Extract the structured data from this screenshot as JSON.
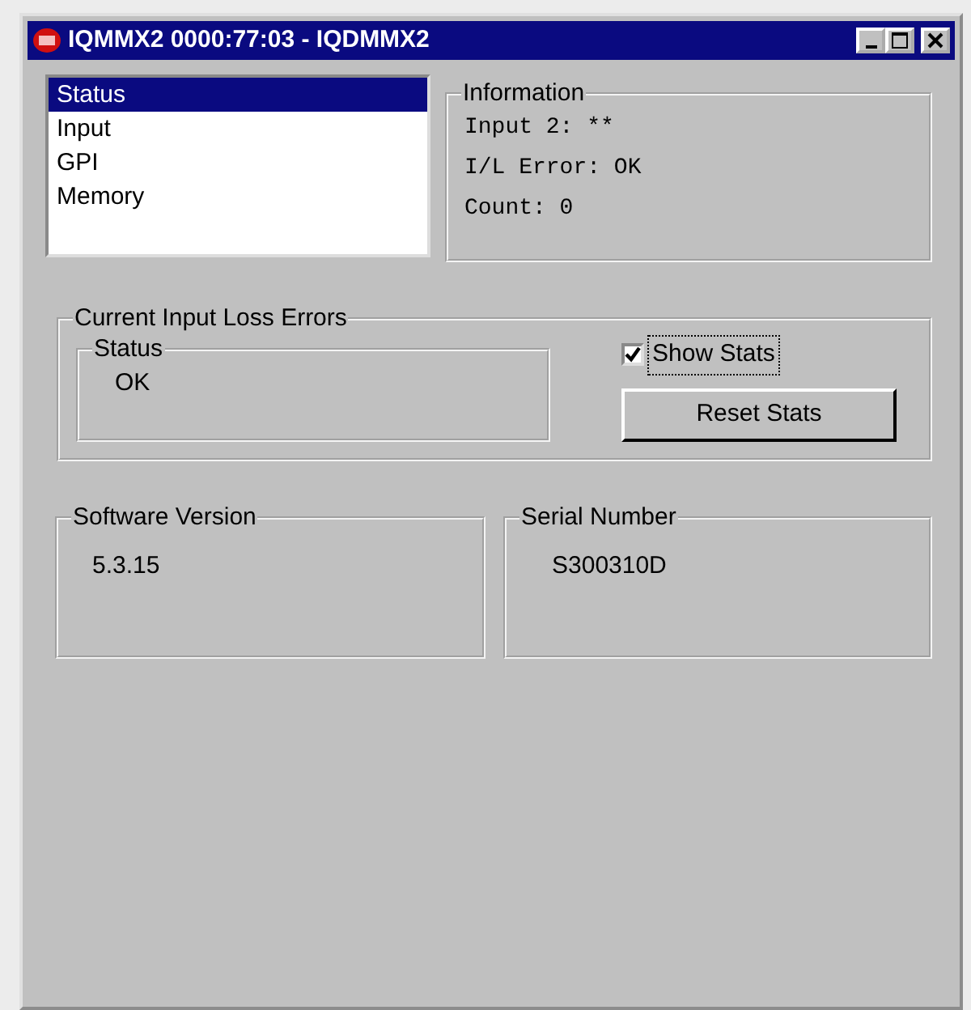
{
  "window": {
    "title": "IQMMX2 0000:77:03 - IQDMMX2"
  },
  "list": [
    {
      "label": "Status",
      "selected": true
    },
    {
      "label": "Input",
      "selected": false
    },
    {
      "label": "GPI",
      "selected": false
    },
    {
      "label": "Memory",
      "selected": false
    }
  ],
  "information": {
    "title": "Information",
    "lines": [
      "Input 2: **",
      "I/L Error: OK",
      "Count: 0"
    ]
  },
  "input_loss": {
    "title": "Current Input Loss Errors",
    "status": {
      "title": "Status",
      "value": "OK"
    },
    "show_stats": {
      "label": "Show Stats",
      "checked": true
    },
    "reset_button": "Reset Stats"
  },
  "software_version": {
    "title": "Software Version",
    "value": "5.3.15"
  },
  "serial_number": {
    "title": "Serial Number",
    "value": "S300310D"
  }
}
